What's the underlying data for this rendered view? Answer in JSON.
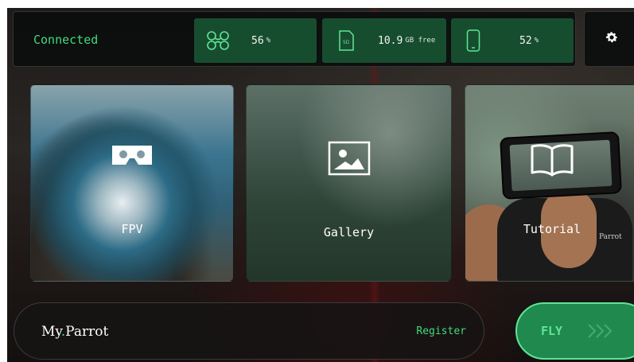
{
  "status": {
    "connection": "Connected",
    "drone_battery": {
      "value": "56",
      "unit": "%",
      "icon": "drone-icon"
    },
    "storage": {
      "value": "10.9",
      "unit": "GB free",
      "icon": "sd-card-icon"
    },
    "phone_battery": {
      "value": "52",
      "unit": "%",
      "icon": "phone-icon"
    },
    "settings_icon": "gear-icon"
  },
  "tiles": {
    "fpv": {
      "label": "FPV",
      "icon": "vr-headset-icon"
    },
    "gallery": {
      "label": "Gallery",
      "icon": "image-icon"
    },
    "tutorial": {
      "label": "Tutorial",
      "icon": "book-icon",
      "brand": "Parrot"
    }
  },
  "myparrot": {
    "logo_my": "My",
    "logo_dot": ".",
    "logo_parrot": "Parrot",
    "register": "Register"
  },
  "fly": {
    "label": "FLY",
    "icon": "chevrons-right-icon"
  },
  "colors": {
    "accent": "#3fdc7a",
    "stat_bg": "#174d2f",
    "fly_bg": "#20894e"
  }
}
